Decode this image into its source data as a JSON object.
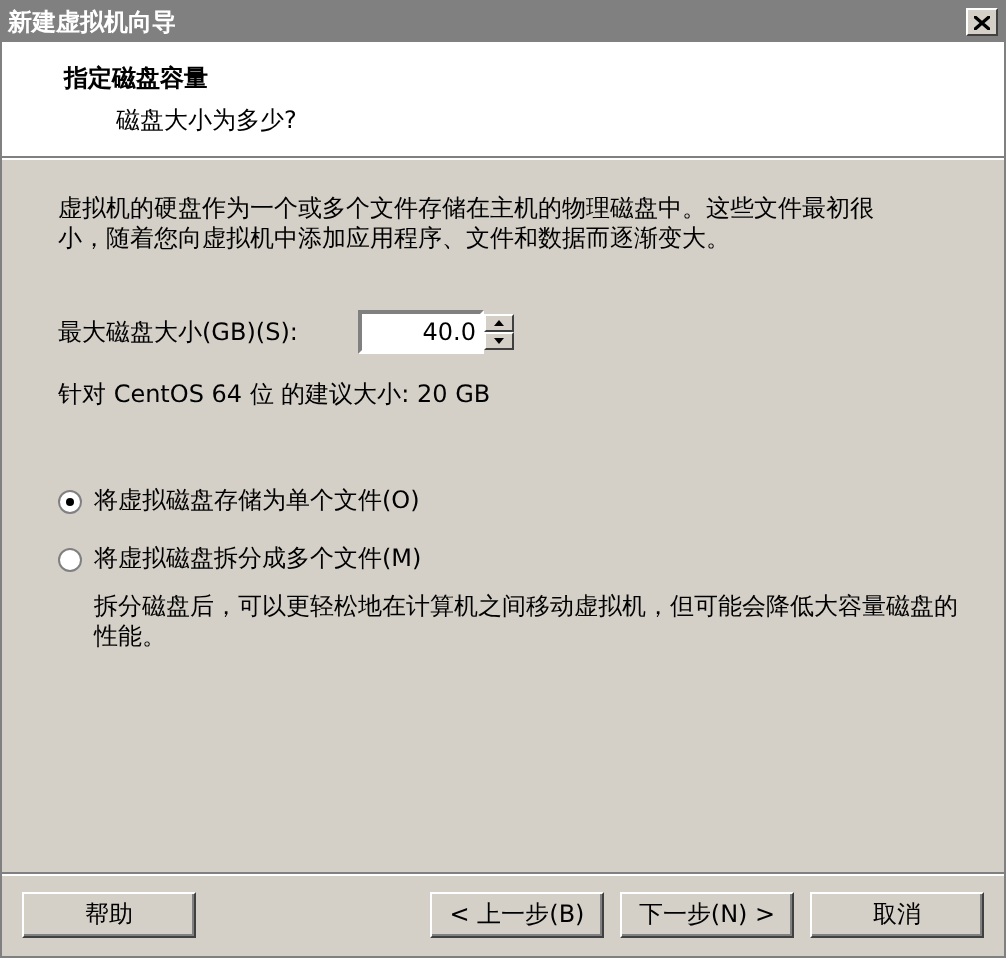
{
  "window": {
    "title": "新建虚拟机向导"
  },
  "header": {
    "title": "指定磁盘容量",
    "subtitle": "磁盘大小为多少?"
  },
  "description": "虚拟机的硬盘作为一个或多个文件存储在主机的物理磁盘中。这些文件最初很小，随着您向虚拟机中添加应用程序、文件和数据而逐渐变大。",
  "disk_size": {
    "label": "最大磁盘大小(GB)(S):",
    "value": "40.0"
  },
  "recommendation": "针对 CentOS 64 位 的建议大小: 20 GB",
  "options": [
    {
      "label": "将虚拟磁盘存储为单个文件(O)",
      "selected": true
    },
    {
      "label": "将虚拟磁盘拆分成多个文件(M)",
      "selected": false,
      "note": "拆分磁盘后，可以更轻松地在计算机之间移动虚拟机，但可能会降低大容量磁盘的性能。"
    }
  ],
  "buttons": {
    "help": "帮助",
    "back": "< 上一步(B)",
    "next": "下一步(N) >",
    "cancel": "取消"
  }
}
